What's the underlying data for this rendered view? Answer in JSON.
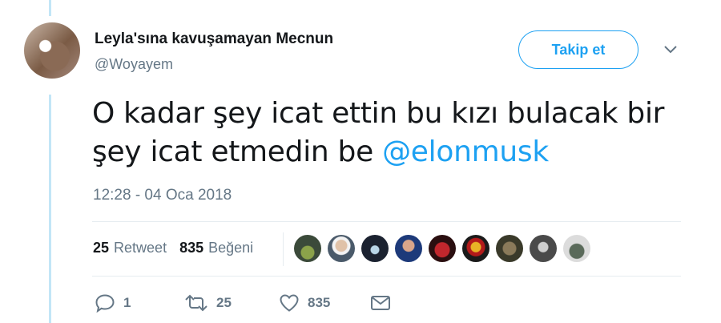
{
  "tweet": {
    "author_name": "Leyla'sına kavuşamayan Mecnun",
    "handle": "@Woyayem",
    "follow_label": "Takip et",
    "text_before_mention": "O kadar şey icat ettin bu kızı bulacak bir şey icat etmedin be ",
    "mention": "@elonmusk",
    "timestamp": "12:28 - 04 Oca 2018"
  },
  "stats": {
    "retweet_count": "25",
    "retweet_label": "Retweet",
    "like_count": "835",
    "like_label": "Beğeni"
  },
  "actions": {
    "reply_count": "1",
    "retweet_count": "25",
    "like_count": "835"
  },
  "icons": [
    "chevron-down-icon",
    "reply-icon",
    "retweet-icon",
    "heart-icon",
    "envelope-icon"
  ],
  "colors": {
    "accent": "#1da1f2",
    "muted_text": "#657786",
    "primary_text": "#14171a",
    "thread_line": "#c2e6f7"
  }
}
